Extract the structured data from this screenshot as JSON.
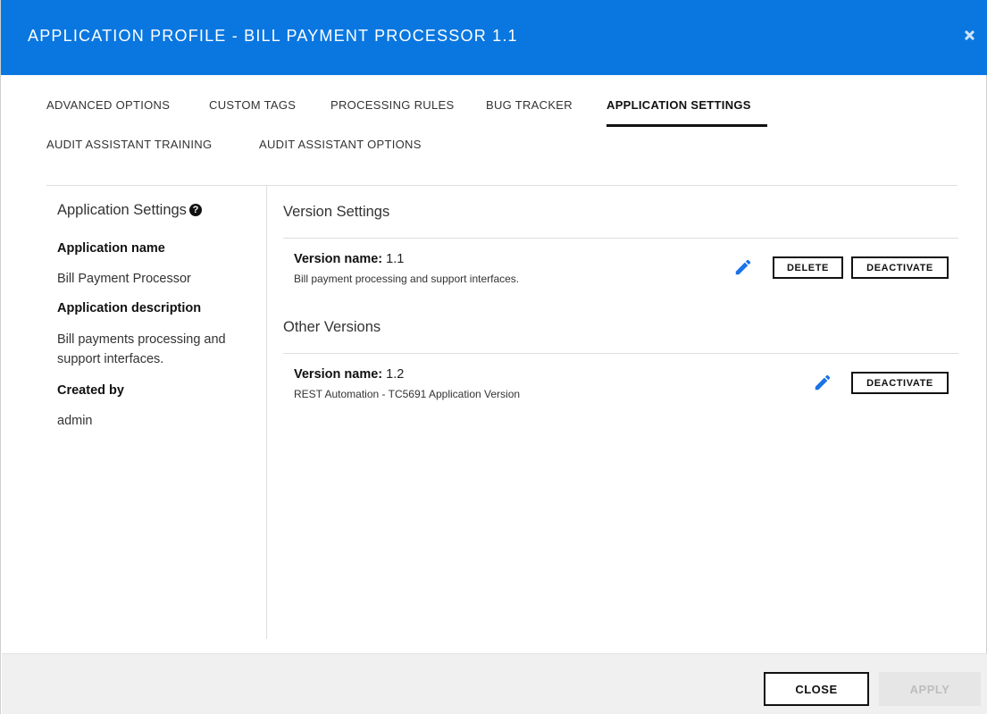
{
  "header": {
    "title": "APPLICATION PROFILE - BILL PAYMENT PROCESSOR 1.1",
    "close_icon": "close-icon"
  },
  "tabs": [
    {
      "label": "ADVANCED OPTIONS",
      "active": false
    },
    {
      "label": "CUSTOM TAGS",
      "active": false
    },
    {
      "label": "PROCESSING RULES",
      "active": false
    },
    {
      "label": "BUG TRACKER",
      "active": false
    },
    {
      "label": "APPLICATION SETTINGS",
      "active": true
    },
    {
      "label": "AUDIT ASSISTANT TRAINING",
      "active": false
    },
    {
      "label": "AUDIT ASSISTANT OPTIONS",
      "active": false
    }
  ],
  "left_panel": {
    "title": "Application Settings",
    "help_icon": "question-circle-icon",
    "app_name_label": "Application name",
    "app_name_value": "Bill Payment Processor",
    "app_description_label": "Application description",
    "app_description_value": "Bill payments processing and support interfaces.",
    "created_by_label": "Created by",
    "created_by_value": "admin"
  },
  "version_settings": {
    "title": "Version Settings",
    "version_label": "Version name:",
    "version_value": "1.1",
    "description": "Bill payment processing and support interfaces.",
    "edit_icon": "pencil-icon",
    "delete_label": "DELETE",
    "deactivate_label": "DEACTIVATE"
  },
  "other_versions": {
    "title": "Other Versions",
    "items": [
      {
        "version_label": "Version name:",
        "version_value": "1.2",
        "description": "REST Automation - TC5691 Application Version",
        "edit_icon": "pencil-icon",
        "deactivate_label": "DEACTIVATE"
      }
    ]
  },
  "footer": {
    "close_label": "CLOSE",
    "apply_label": "APPLY"
  },
  "colors": {
    "header_bg": "#0a77e0",
    "accent_pencil": "#1a73e8",
    "footer_bg": "#f0f0f0"
  }
}
